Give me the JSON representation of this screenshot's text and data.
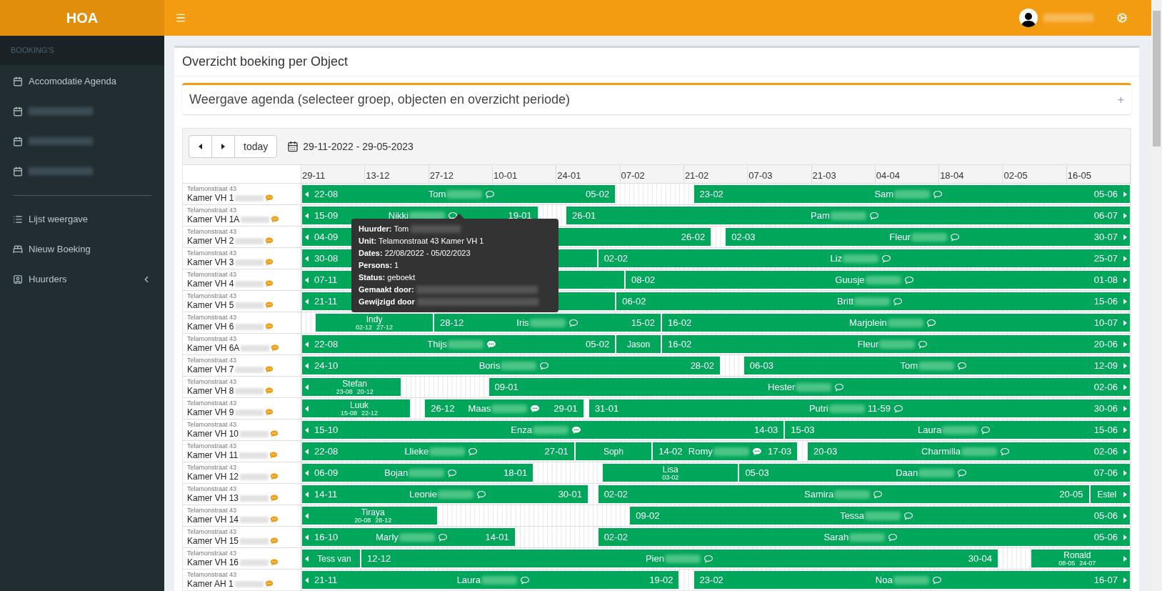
{
  "brand": "HOA",
  "sidebar": {
    "header": "BOOKING'S",
    "items": [
      {
        "kind": "link",
        "label": "Accomodatie Agenda"
      },
      {
        "kind": "link",
        "redacted": true
      },
      {
        "kind": "link",
        "redacted": true
      },
      {
        "kind": "link",
        "redacted": true
      },
      {
        "kind": "divider"
      },
      {
        "kind": "link",
        "label": "Lijst weergave"
      },
      {
        "kind": "link",
        "label": "Nieuw Boeking"
      },
      {
        "kind": "link",
        "label": "Huurders",
        "chevron": true
      }
    ]
  },
  "topbar": {
    "user_redacted": true
  },
  "page_title": "Overzicht boeking per Object",
  "filter_box": {
    "title": "Weergave agenda (selecteer groep, objecten en overzicht periode)",
    "expand": "+"
  },
  "calendar": {
    "today_button": "today",
    "date_range": "29-11-2022 - 29-05-2023",
    "ticks": [
      "29-11",
      "13-12",
      "27-12",
      "10-01",
      "24-01",
      "07-02",
      "21-02",
      "07-03",
      "21-03",
      "04-04",
      "18-04",
      "02-05",
      "16-05"
    ],
    "rows": [
      {
        "address": "Telamonstraat 43",
        "unit": "Kamer VH 1",
        "bookings": [
          {
            "kind": "full",
            "from": "22-08",
            "name": "Tom",
            "redacted": true,
            "comment": true,
            "comment_filled": false,
            "to": "05-02"
          },
          {
            "kind": "full",
            "from": "23-02",
            "name": "Sam",
            "redacted": true,
            "comment": true,
            "comment_filled": false,
            "to": "05-06"
          }
        ]
      },
      {
        "address": "Telamonstraat 43",
        "unit": "Kamer VH 1A",
        "bookings": [
          {
            "kind": "full",
            "from": "15-09",
            "name": "Nikki",
            "redacted": true,
            "comment": true,
            "comment_filled": false,
            "to": "19-01"
          },
          {
            "kind": "full",
            "from": "26-01",
            "name": "Pam",
            "redacted": true,
            "comment": true,
            "comment_filled": false,
            "to": "06-07"
          }
        ]
      },
      {
        "address": "Telamonstraat 43",
        "unit": "Kamer VH 2",
        "bookings": [
          {
            "kind": "full",
            "from": "04-09",
            "to": "26-02"
          },
          {
            "kind": "full",
            "from": "02-03",
            "name": "Fleur",
            "redacted": true,
            "comment": true,
            "comment_filled": false,
            "to": "30-07"
          }
        ]
      },
      {
        "address": "Telamonstraat 43",
        "unit": "Kamer VH 3",
        "bookings": [
          {
            "kind": "full",
            "from": "30-08"
          },
          {
            "kind": "full",
            "from": "02-02",
            "name": "Liz",
            "redacted": true,
            "comment": true,
            "comment_filled": false,
            "to": "25-07"
          }
        ]
      },
      {
        "address": "Telamonstraat 43",
        "unit": "Kamer VH 4",
        "bookings": [
          {
            "kind": "full",
            "from": "07-11"
          },
          {
            "kind": "full",
            "from": "08-02",
            "name": "Guusje",
            "redacted": true,
            "comment": true,
            "comment_filled": false,
            "to": "01-08"
          }
        ]
      },
      {
        "address": "Telamonstraat 43",
        "unit": "Kamer VH 5",
        "bookings": [
          {
            "kind": "full",
            "from": "21-11"
          },
          {
            "kind": "full",
            "from": "06-02",
            "name": "Britt",
            "redacted": true,
            "comment": true,
            "comment_filled": false,
            "to": "15-06"
          }
        ]
      },
      {
        "address": "Telamonstraat 43",
        "unit": "Kamer VH 6",
        "bookings": [
          {
            "kind": "compact",
            "from": "02-12",
            "name": "Indy",
            "to": "27-12"
          },
          {
            "kind": "full",
            "from": "28-12",
            "name": "Iris",
            "redacted": true,
            "comment": true,
            "comment_filled": false,
            "to": "15-02"
          },
          {
            "kind": "full",
            "from": "16-02",
            "name": "Marjolein",
            "redacted": true,
            "comment": true,
            "comment_filled": false,
            "to": "10-07"
          }
        ]
      },
      {
        "address": "Telamonstraat 43",
        "unit": "Kamer VH 6A",
        "bookings": [
          {
            "kind": "full",
            "from": "22-08",
            "name": "Thijs",
            "redacted": true,
            "comment": true,
            "comment_filled": true,
            "to": "05-02"
          },
          {
            "kind": "compact",
            "name": "Jason"
          },
          {
            "kind": "full",
            "from": "16-02",
            "name": "Fleur",
            "redacted": true,
            "comment": true,
            "comment_filled": false,
            "to": "20-06"
          }
        ]
      },
      {
        "address": "Telamonstraat 43",
        "unit": "Kamer VH 7",
        "bookings": [
          {
            "kind": "full",
            "from": "24-10",
            "name": "Boris",
            "redacted": true,
            "comment": true,
            "comment_filled": false,
            "to": "28-02"
          },
          {
            "kind": "full",
            "from": "06-03",
            "name": "Tom",
            "redacted": true,
            "comment": true,
            "comment_filled": false,
            "to": "12-09"
          }
        ]
      },
      {
        "address": "Telamonstraat 43",
        "unit": "Kamer VH 8",
        "bookings": [
          {
            "kind": "compact",
            "from": "23-08",
            "name": "Stefan",
            "to": "20-12"
          },
          {
            "kind": "full",
            "from": "09-01",
            "name": "Hester",
            "redacted": true,
            "comment": true,
            "comment_filled": false,
            "to": "02-06"
          }
        ]
      },
      {
        "address": "Telamonstraat 43",
        "unit": "Kamer VH 9",
        "bookings": [
          {
            "kind": "compact",
            "from": "15-08",
            "name": "Luuk",
            "to": "22-12"
          },
          {
            "kind": "full",
            "from": "26-12",
            "name": "Maas",
            "redacted": true,
            "comment": true,
            "comment_filled": true,
            "to": "29-01"
          },
          {
            "kind": "full",
            "from": "31-01",
            "name": "Putri",
            "redacted": true,
            "suffix": "11-59",
            "comment": true,
            "comment_filled": false,
            "to": "30-06"
          }
        ]
      },
      {
        "address": "Telamonstraat 43",
        "unit": "Kamer VH 10",
        "bookings": [
          {
            "kind": "full",
            "from": "15-10",
            "name": "Enza",
            "redacted": true,
            "comment": true,
            "comment_filled": true,
            "to": "14-03"
          },
          {
            "kind": "full",
            "from": "15-03",
            "name": "Laura",
            "redacted": true,
            "comment": true,
            "comment_filled": false,
            "to": "15-06"
          }
        ]
      },
      {
        "address": "Telamonstraat 43",
        "unit": "Kamer VH 11",
        "bookings": [
          {
            "kind": "full",
            "from": "22-08",
            "name": "Llieke",
            "redacted": true,
            "comment": true,
            "comment_filled": false,
            "to": "27-01"
          },
          {
            "kind": "compact",
            "name": "Soph"
          },
          {
            "kind": "full",
            "from": "14-02",
            "name": "Romy",
            "redacted": true,
            "comment": true,
            "comment_filled": true,
            "to": "17-03"
          },
          {
            "kind": "full",
            "from": "20-03",
            "name": "Charmilla",
            "redacted": true,
            "comment": true,
            "comment_filled": false,
            "to": "02-06"
          }
        ]
      },
      {
        "address": "Telamonstraat 43",
        "unit": "Kamer VH 12",
        "bookings": [
          {
            "kind": "full",
            "from": "06-09",
            "name": "Bojan",
            "redacted": true,
            "comment": true,
            "comment_filled": false,
            "to": "18-01"
          },
          {
            "kind": "compact",
            "from": "03-02",
            "name": "Lisa"
          },
          {
            "kind": "full",
            "from": "05-03",
            "name": "Daan",
            "redacted": true,
            "comment": true,
            "comment_filled": false,
            "to": "07-06"
          }
        ]
      },
      {
        "address": "Telamonstraat 43",
        "unit": "Kamer VH 13",
        "bookings": [
          {
            "kind": "full",
            "from": "14-11",
            "name": "Leonie",
            "redacted": true,
            "comment": true,
            "comment_filled": false,
            "to": "30-01"
          },
          {
            "kind": "full",
            "from": "02-02",
            "name": "Samira",
            "redacted": true,
            "comment": true,
            "comment_filled": false,
            "to": "20-05"
          },
          {
            "kind": "compact",
            "name": "Estel"
          }
        ]
      },
      {
        "address": "Telamonstraat 43",
        "unit": "Kamer VH 14",
        "bookings": [
          {
            "kind": "compact",
            "from": "20-08",
            "name": "Tiraya",
            "to": "28-12"
          },
          {
            "kind": "full",
            "from": "09-02",
            "name": "Tessa",
            "redacted": true,
            "comment": true,
            "comment_filled": false,
            "to": "05-06"
          }
        ]
      },
      {
        "address": "Telamonstraat 43",
        "unit": "Kamer VH 15",
        "bookings": [
          {
            "kind": "full",
            "from": "16-10",
            "name": "Marly",
            "redacted": true,
            "comment": true,
            "comment_filled": false,
            "to": "14-01"
          },
          {
            "kind": "full",
            "from": "02-02",
            "name": "Sarah",
            "redacted": true,
            "comment": true,
            "comment_filled": false,
            "to": "05-06"
          }
        ]
      },
      {
        "address": "Telamonstraat 43",
        "unit": "Kamer VH 16",
        "bookings": [
          {
            "kind": "compact",
            "name": "Tess van"
          },
          {
            "kind": "full",
            "from": "12-12",
            "name": "Pien",
            "redacted": true,
            "comment": true,
            "comment_filled": false,
            "to": "30-04"
          },
          {
            "kind": "compact",
            "from": "08-05",
            "name": "Ronald",
            "to": "24-07"
          }
        ]
      },
      {
        "address": "Telamonstraat 43",
        "unit": "Kamer AH 1",
        "bookings": [
          {
            "kind": "full",
            "from": "21-11",
            "name": "Laura",
            "redacted": true,
            "comment": true,
            "comment_filled": false,
            "to": "19-02"
          },
          {
            "kind": "full",
            "from": "23-02",
            "name": "Noa",
            "redacted": true,
            "comment": true,
            "comment_filled": false,
            "to": "16-07"
          }
        ]
      }
    ],
    "tooltip": {
      "lines": [
        {
          "label": "Huurder:",
          "value": "Tom",
          "redacted": true
        },
        {
          "label": "Unit:",
          "value": "Telamonstraat 43 Kamer VH 1"
        },
        {
          "label": "Dates:",
          "value": "22/08/2022 - 05/02/2023"
        },
        {
          "label": "Persons:",
          "value": "1"
        },
        {
          "label": "Status:",
          "value": "geboekt"
        },
        {
          "label": "Gemaakt door:",
          "redacted": true
        },
        {
          "label": "Gewijzigd door",
          "redacted": true
        }
      ]
    }
  }
}
